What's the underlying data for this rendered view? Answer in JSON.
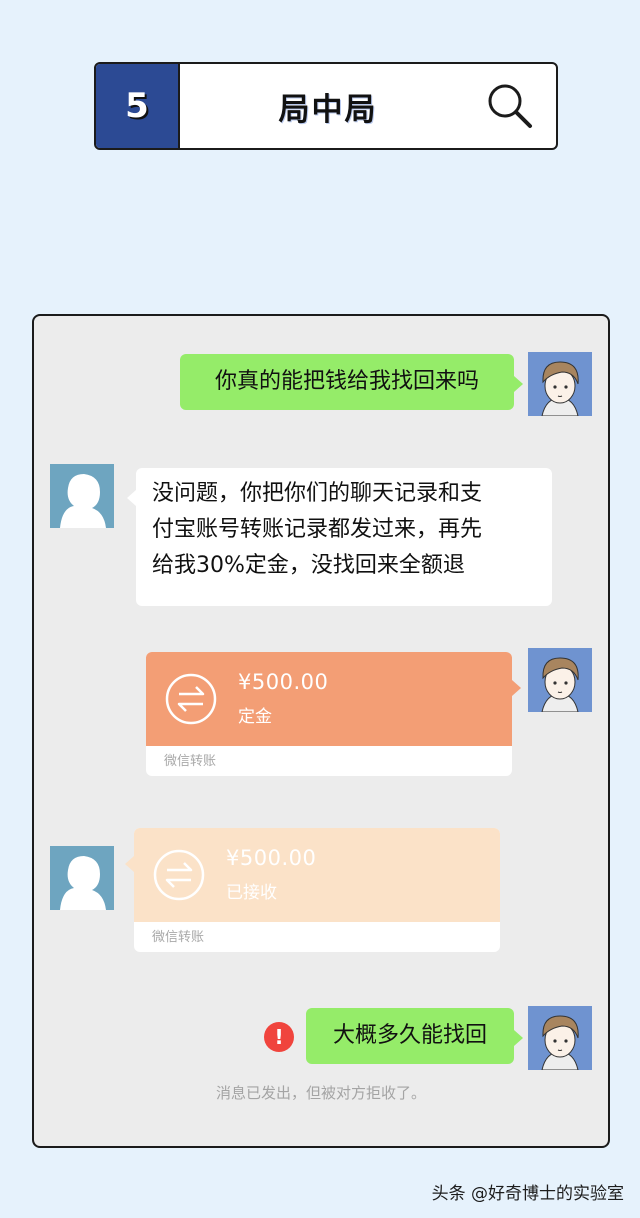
{
  "header": {
    "episode_number": "5",
    "title": "局中局"
  },
  "messages": {
    "m1_text": "你真的能把钱给我找回来吗",
    "m2_lines": [
      "没问题，你把你们的聊天记录和支",
      "付宝账号转账记录都发过来，再先",
      "给我30%定金，没找回来全额退"
    ],
    "transfer_sent": {
      "amount": "¥500.00",
      "status": "定金",
      "source": "微信转账"
    },
    "transfer_received": {
      "amount": "¥500.00",
      "status": "已接收",
      "source": "微信转账"
    },
    "m5_text": "大概多久能找回",
    "error_mark": "!",
    "notice": "消息已发出，但被对方拒收了。"
  },
  "watermark": "头条 @好奇博士的实验室",
  "colors": {
    "background": "#e6f2fc",
    "header_number_bg": "#2c4a94",
    "green_bubble": "#95ec69",
    "transfer_sent": "#f39e75",
    "transfer_received": "#fbe2c8",
    "error": "#f0443d"
  },
  "icons": {
    "search": "magnifier-icon",
    "transfer": "transfer-arrows-icon",
    "error": "exclamation-icon"
  }
}
